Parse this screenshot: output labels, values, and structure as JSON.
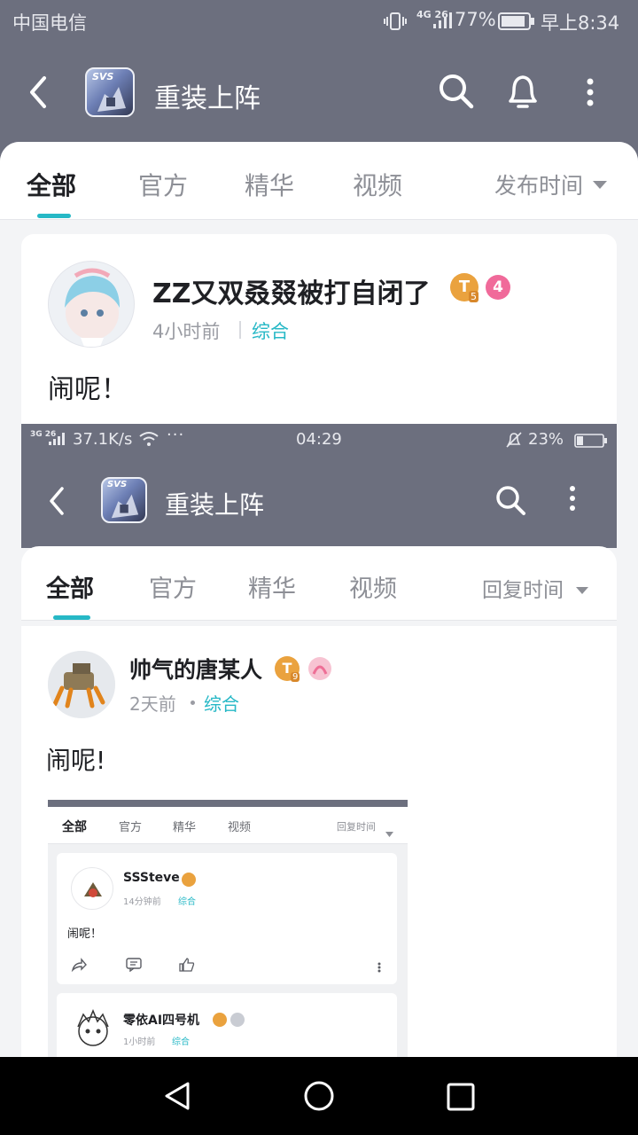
{
  "status_bar": {
    "carrier": "中国电信",
    "network": "4G 26",
    "battery": "77%",
    "time": "早上8:34"
  },
  "app_bar": {
    "title": "重装上阵",
    "app_icon_text": "SVS"
  },
  "tabs": {
    "items": [
      "全部",
      "官方",
      "精华",
      "视频"
    ],
    "active_index": 0,
    "sort_label": "发布时间"
  },
  "post": {
    "username": "ZZ又双叒叕被打自闭了",
    "tier_badge": "T",
    "tier_level": "5",
    "level_badge": "4",
    "time": "4小时前",
    "category": "综合",
    "content": "闹呢！"
  },
  "screenshot1": {
    "status_bar": {
      "network": "3G 26",
      "speed": "37.1K/s",
      "time": "04:29",
      "battery": "23%"
    },
    "app_bar": {
      "title": "重装上阵",
      "app_icon_text": "SVS"
    },
    "tabs": {
      "items": [
        "全部",
        "官方",
        "精华",
        "视频"
      ],
      "sort_label": "回复时间"
    },
    "post": {
      "username": "帅气的唐某人",
      "tier_badge": "T",
      "tier_level": "9",
      "time": "2天前",
      "category": "综合",
      "content": "闹呢!"
    },
    "screenshot2": {
      "tabs": {
        "items": [
          "全部",
          "官方",
          "精华",
          "视频"
        ],
        "sort_label": "回复时间"
      },
      "posts": [
        {
          "username": "SSSteve",
          "time": "14分钟前",
          "category": "综合",
          "content": "闹呢！"
        },
        {
          "username": "零依AI四号机",
          "time": "1小时前",
          "category": "综合"
        }
      ]
    }
  },
  "nav_bar": {
    "back": "back",
    "home": "home",
    "recents": "recents"
  },
  "colors": {
    "header_bg": "#6c6f7e",
    "accent": "#26b8c6",
    "tier_badge": "#eaa23e",
    "level_badge": "#f06a9a"
  }
}
